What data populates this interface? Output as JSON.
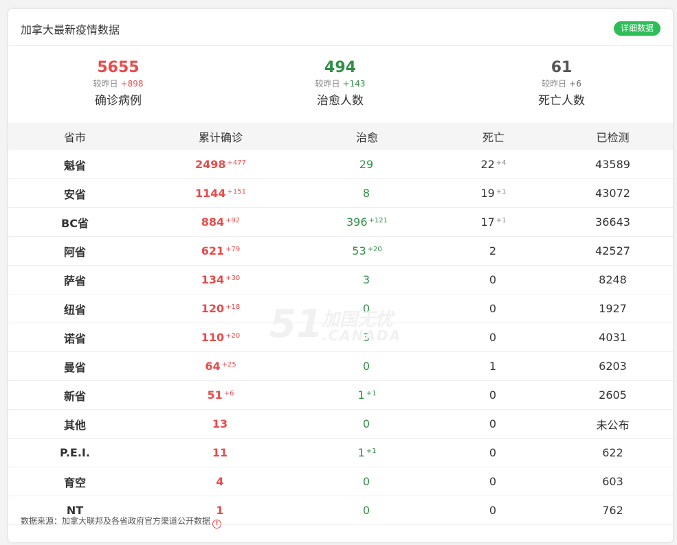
{
  "header": {
    "title": "加拿大最新疫情数据",
    "detail_label": "详细数据"
  },
  "summary": [
    {
      "value": "5655",
      "delta_label": "较昨日",
      "delta": "+898",
      "label": "确诊病例",
      "color": "#e84b4b"
    },
    {
      "value": "494",
      "delta_label": "较昨日",
      "delta": "+143",
      "label": "治愈人数",
      "color": "#2f8f46"
    },
    {
      "value": "61",
      "delta_label": "较昨日",
      "delta": "+6",
      "label": "死亡人数",
      "color": "#555555"
    }
  ],
  "table": {
    "headers": [
      "省市",
      "累计确诊",
      "治愈",
      "死亡",
      "已检测"
    ],
    "rows": [
      {
        "province": "魁省",
        "confirmed": "2498",
        "confirmed_delta": "+477",
        "recovered": "29",
        "recovered_delta": "",
        "deaths": "22",
        "deaths_delta": "+4",
        "tested": "43589"
      },
      {
        "province": "安省",
        "confirmed": "1144",
        "confirmed_delta": "+151",
        "recovered": "8",
        "recovered_delta": "",
        "deaths": "19",
        "deaths_delta": "+1",
        "tested": "43072"
      },
      {
        "province": "BC省",
        "confirmed": "884",
        "confirmed_delta": "+92",
        "recovered": "396",
        "recovered_delta": "+121",
        "deaths": "17",
        "deaths_delta": "+1",
        "tested": "36643"
      },
      {
        "province": "阿省",
        "confirmed": "621",
        "confirmed_delta": "+79",
        "recovered": "53",
        "recovered_delta": "+20",
        "deaths": "2",
        "deaths_delta": "",
        "tested": "42527"
      },
      {
        "province": "萨省",
        "confirmed": "134",
        "confirmed_delta": "+30",
        "recovered": "3",
        "recovered_delta": "",
        "deaths": "0",
        "deaths_delta": "",
        "tested": "8248"
      },
      {
        "province": "纽省",
        "confirmed": "120",
        "confirmed_delta": "+18",
        "recovered": "0",
        "recovered_delta": "",
        "deaths": "0",
        "deaths_delta": "",
        "tested": "1927"
      },
      {
        "province": "诺省",
        "confirmed": "110",
        "confirmed_delta": "+20",
        "recovered": "3",
        "recovered_delta": "",
        "deaths": "0",
        "deaths_delta": "",
        "tested": "4031"
      },
      {
        "province": "曼省",
        "confirmed": "64",
        "confirmed_delta": "+25",
        "recovered": "0",
        "recovered_delta": "",
        "deaths": "1",
        "deaths_delta": "",
        "tested": "6203"
      },
      {
        "province": "新省",
        "confirmed": "51",
        "confirmed_delta": "+6",
        "recovered": "1",
        "recovered_delta": "+1",
        "deaths": "0",
        "deaths_delta": "",
        "tested": "2605"
      },
      {
        "province": "其他",
        "confirmed": "13",
        "confirmed_delta": "",
        "recovered": "0",
        "recovered_delta": "",
        "deaths": "0",
        "deaths_delta": "",
        "tested": "未公布"
      },
      {
        "province": "P.E.I.",
        "confirmed": "11",
        "confirmed_delta": "",
        "recovered": "1",
        "recovered_delta": "+1",
        "deaths": "0",
        "deaths_delta": "",
        "tested": "622"
      },
      {
        "province": "育空",
        "confirmed": "4",
        "confirmed_delta": "",
        "recovered": "0",
        "recovered_delta": "",
        "deaths": "0",
        "deaths_delta": "",
        "tested": "603"
      },
      {
        "province": "NT",
        "confirmed": "1",
        "confirmed_delta": "",
        "recovered": "0",
        "recovered_delta": "",
        "deaths": "0",
        "deaths_delta": "",
        "tested": "762"
      }
    ]
  },
  "watermark": {
    "number": "51",
    "cn": "加国无忧",
    "en": ".CANADA"
  },
  "footer": {
    "source": "数据来源：加拿大联邦及各省政府官方渠道公开数据",
    "info_icon": "info-icon"
  }
}
